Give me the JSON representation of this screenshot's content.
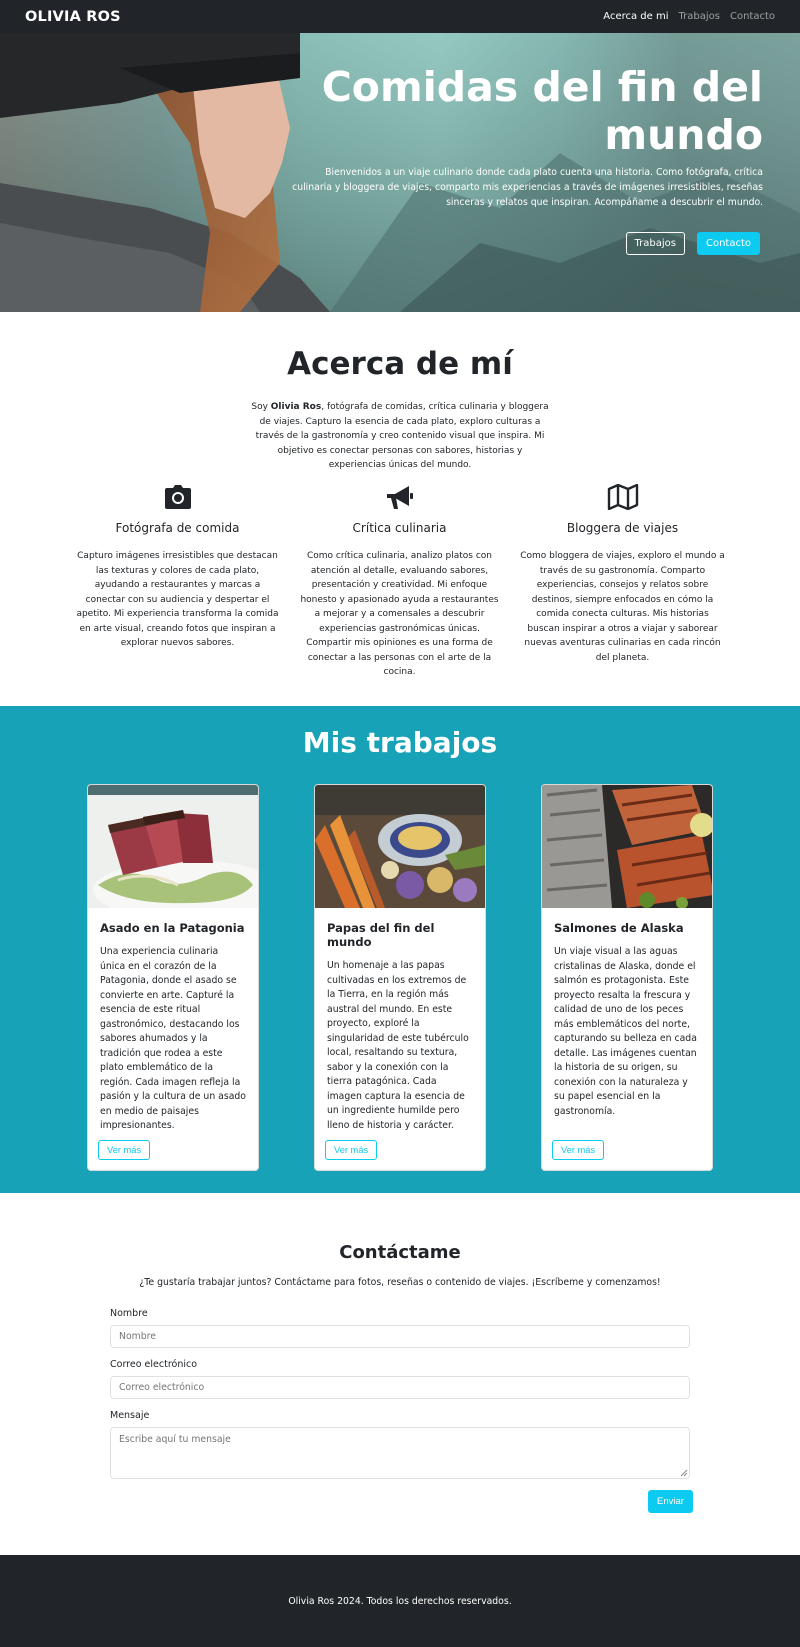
{
  "navbar": {
    "brand": "OLIVIA ROS",
    "links": [
      "Acerca de mi",
      "Trabajos",
      "Contacto"
    ]
  },
  "hero": {
    "title": "Comidas del fin del mundo",
    "subtitle": "Bienvenidos a un viaje culinario donde cada plato cuenta una historia. Como fotógrafa, crítica culinaria y bloggera de viajes, comparto mis experiencias a través de imágenes irresistibles, reseñas sinceras y relatos que inspiran. Acompáñame a descubrir el mundo.",
    "btn_works": "Trabajos",
    "btn_contact": "Contacto"
  },
  "about": {
    "title": "Acerca de mí",
    "intro_prefix": "Soy ",
    "intro_name": "Olivia Ros",
    "intro_rest": ", fotógrafa de comidas, crítica culinaria y bloggera de viajes. Capturo la esencia de cada plato, exploro culturas a través de la gastronomía y creo contenido visual que inspira. Mi objetivo es conectar personas con sabores, historias y experiencias únicas del mundo.",
    "features": [
      {
        "icon": "camera-icon",
        "title": "Fotógrafa de comida",
        "text": "Capturo imágenes irresistibles que destacan las texturas y colores de cada plato, ayudando a restaurantes y marcas a conectar con su audiencia y despertar el apetito. Mi experiencia transforma la comida en arte visual, creando fotos que inspiran a explorar nuevos sabores."
      },
      {
        "icon": "megaphone-icon",
        "title": "Crítica culinaria",
        "text": "Como crítica culinaria, analizo platos con atención al detalle, evaluando sabores, presentación y creatividad. Mi enfoque honesto y apasionado ayuda a restaurantes a mejorar y a comensales a descubrir experiencias gastronómicas únicas. Compartir mis opiniones es una forma de conectar a las personas con el arte de la cocina."
      },
      {
        "icon": "map-icon",
        "title": "Bloggera de viajes",
        "text": "Como bloggera de viajes, exploro el mundo a través de su gastronomía. Comparto experiencias, consejos y relatos sobre destinos, siempre enfocados en cómo la comida conecta culturas. Mis historias buscan inspirar a otros a viajar y saborear nuevas aventuras culinarias en cada rincón del planeta."
      }
    ]
  },
  "works": {
    "title": "Mis trabajos",
    "cards": [
      {
        "title": "Asado en la Patagonia",
        "text": "Una experiencia culinaria única en el corazón de la Patagonia, donde el asado se convierte en arte. Capturé la esencia de este ritual gastronómico, destacando los sabores ahumados y la tradición que rodea a este plato emblemático de la región. Cada imagen refleja la pasión y la cultura de un asado en medio de paisajes impresionantes.",
        "button": "Ver más"
      },
      {
        "title": "Papas del fin del mundo",
        "text": "Un homenaje a las papas cultivadas en los extremos de la Tierra, en la región más austral del mundo. En este proyecto, exploré la singularidad de este tubérculo local, resaltando su textura, sabor y la conexión con la tierra patagónica. Cada imagen captura la esencia de un ingrediente humilde pero lleno de historia y carácter.",
        "button": "Ver más"
      },
      {
        "title": "Salmones de Alaska",
        "text": "Un viaje visual a las aguas cristalinas de Alaska, donde el salmón es protagonista. Este proyecto resalta la frescura y calidad de uno de los peces más emblemáticos del norte, capturando su belleza en cada detalle. Las imágenes cuentan la historia de su origen, su conexión con la naturaleza y su papel esencial en la gastronomía.",
        "button": "Ver más"
      }
    ]
  },
  "contact": {
    "title": "Contáctame",
    "intro": "¿Te gustaría trabajar juntos? Contáctame para fotos, reseñas o contenido de viajes. ¡Escríbeme y comenzamos!",
    "name_label": "Nombre",
    "name_placeholder": "Nombre",
    "email_label": "Correo electrónico",
    "email_placeholder": "Correo electrónico",
    "message_label": "Mensaje",
    "message_placeholder": "Escribe aquí tu mensaje",
    "submit": "Enviar"
  },
  "footer": {
    "text": "Olivia Ros 2024. Todos los derechos reservados."
  },
  "colors": {
    "dark": "#212529",
    "teal": "#17a2b8",
    "info": "#0dcaf0"
  }
}
